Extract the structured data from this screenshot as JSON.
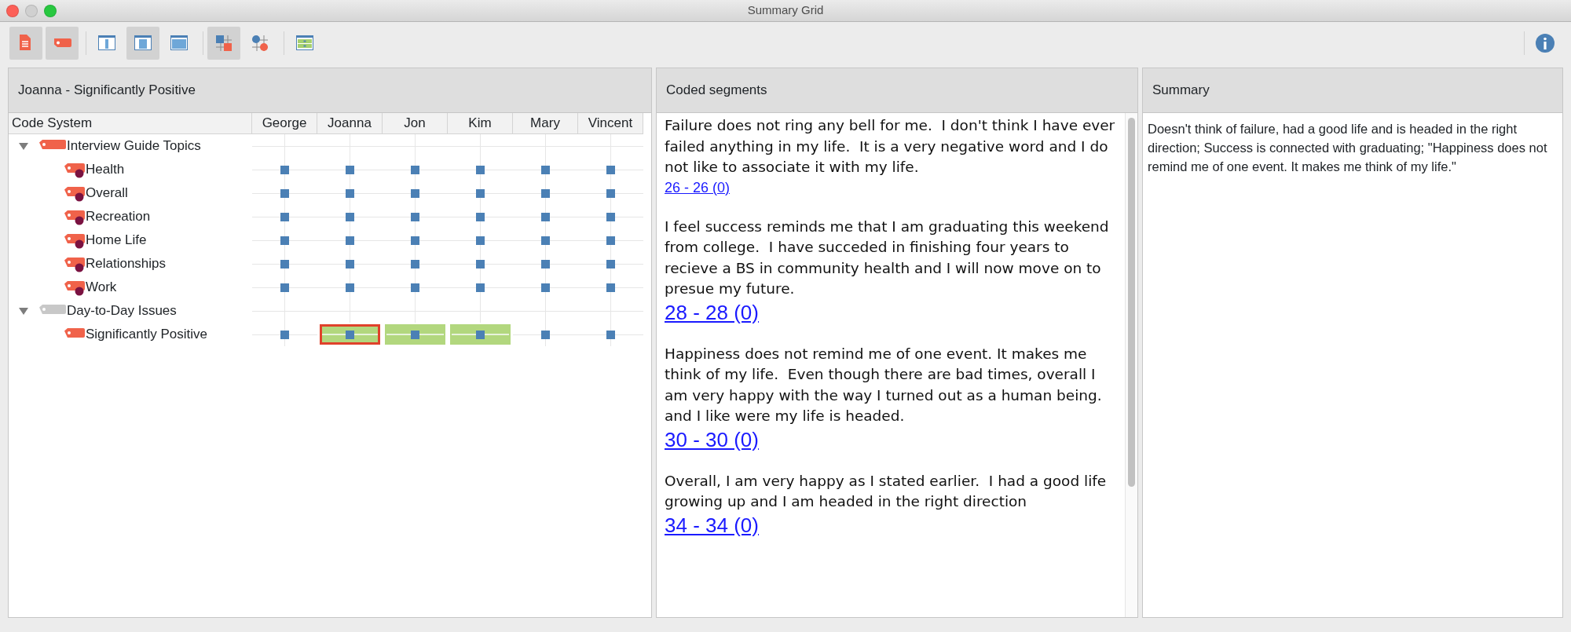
{
  "window": {
    "title": "Summary Grid",
    "minimize_enabled": false
  },
  "toolbar": {
    "groups": [
      [
        {
          "kind": "document",
          "selected": true
        },
        {
          "kind": "tag",
          "selected": true
        }
      ],
      [
        {
          "kind": "layout-narrow",
          "selected": false
        },
        {
          "kind": "layout-wide",
          "selected": true
        },
        {
          "kind": "layout-full",
          "selected": false
        }
      ],
      [
        {
          "kind": "grid-squares",
          "selected": true
        },
        {
          "kind": "grid-circles",
          "selected": false
        }
      ],
      [
        {
          "kind": "table-rows",
          "selected": false
        }
      ]
    ]
  },
  "grid_panel": {
    "title": "Joanna - Significantly Positive",
    "columns": [
      "Code System",
      "George",
      "Joanna",
      "Jon",
      "Kim",
      "Mary",
      "Vincent"
    ],
    "tree": [
      {
        "label": "Interview Guide Topics",
        "color": "#f0624a",
        "expanded": true,
        "children": [
          {
            "label": "Health",
            "color": "#f0624a",
            "has_memo": true,
            "cells": [
              {
                "highlighted": false,
                "selected": false
              },
              {
                "highlighted": false,
                "selected": false
              },
              {
                "highlighted": false,
                "selected": false
              },
              {
                "highlighted": false,
                "selected": false
              },
              {
                "highlighted": false,
                "selected": false
              },
              {
                "highlighted": false,
                "selected": false
              }
            ]
          },
          {
            "label": "Overall",
            "color": "#f0624a",
            "has_memo": true,
            "cells": [
              {
                "highlighted": false,
                "selected": false
              },
              {
                "highlighted": false,
                "selected": false
              },
              {
                "highlighted": false,
                "selected": false
              },
              {
                "highlighted": false,
                "selected": false
              },
              {
                "highlighted": false,
                "selected": false
              },
              {
                "highlighted": false,
                "selected": false
              }
            ]
          },
          {
            "label": "Recreation",
            "color": "#f0624a",
            "has_memo": true,
            "cells": [
              {
                "highlighted": false,
                "selected": false
              },
              {
                "highlighted": false,
                "selected": false
              },
              {
                "highlighted": false,
                "selected": false
              },
              {
                "highlighted": false,
                "selected": false
              },
              {
                "highlighted": false,
                "selected": false
              },
              {
                "highlighted": false,
                "selected": false
              }
            ]
          },
          {
            "label": "Home Life",
            "color": "#f0624a",
            "has_memo": true,
            "cells": [
              {
                "highlighted": false,
                "selected": false
              },
              {
                "highlighted": false,
                "selected": false
              },
              {
                "highlighted": false,
                "selected": false
              },
              {
                "highlighted": false,
                "selected": false
              },
              {
                "highlighted": false,
                "selected": false
              },
              {
                "highlighted": false,
                "selected": false
              }
            ]
          },
          {
            "label": "Relationships",
            "color": "#f0624a",
            "has_memo": true,
            "cells": [
              {
                "highlighted": false,
                "selected": false
              },
              {
                "highlighted": false,
                "selected": false
              },
              {
                "highlighted": false,
                "selected": false
              },
              {
                "highlighted": false,
                "selected": false
              },
              {
                "highlighted": false,
                "selected": false
              },
              {
                "highlighted": false,
                "selected": false
              }
            ]
          },
          {
            "label": "Work",
            "color": "#f0624a",
            "has_memo": true,
            "cells": [
              {
                "highlighted": false,
                "selected": false
              },
              {
                "highlighted": false,
                "selected": false
              },
              {
                "highlighted": false,
                "selected": false
              },
              {
                "highlighted": false,
                "selected": false
              },
              {
                "highlighted": false,
                "selected": false
              },
              {
                "highlighted": false,
                "selected": false
              }
            ]
          }
        ]
      },
      {
        "label": "Day-to-Day Issues",
        "color": "#c8c8c8",
        "expanded": true,
        "children": [
          {
            "label": "Significantly Positive",
            "color": "#f0624a",
            "has_memo": false,
            "cells": [
              {
                "highlighted": false,
                "selected": false
              },
              {
                "highlighted": true,
                "selected": true
              },
              {
                "highlighted": true,
                "selected": false
              },
              {
                "highlighted": true,
                "selected": false
              },
              {
                "highlighted": false,
                "selected": false
              },
              {
                "highlighted": false,
                "selected": false
              }
            ]
          }
        ]
      }
    ]
  },
  "segments_panel": {
    "title": "Coded segments",
    "segments": [
      {
        "text": "Failure does not ring any bell for me.  I don't think I have ever failed anything in my life.  It is a very negative word and I do not like to associate it with my life.",
        "link": "26 - 26  (0)",
        "kind": "small"
      },
      {
        "text": "I feel success reminds me that I am graduating this weekend from college.  I have succeded in finishing four years to recieve a BS in community health and I will now move on to presue my future.",
        "link": "28 - 28  (0)",
        "kind": "large"
      },
      {
        "text": "Happiness does not remind me of one event. It makes me think of my life.  Even though there are bad times, overall I am very happy with the way I turned out as a human being. and I like were my life is headed.",
        "link": "30 - 30  (0)",
        "kind": "large"
      },
      {
        "text": "Overall, I am very happy as I stated earlier.  I had a good life growing up and I am headed in the right direction",
        "link": "34 - 34  (0)",
        "kind": "large"
      }
    ]
  },
  "summary_panel": {
    "title": "Summary",
    "text": "Doesn't think of failure, had a good life and is headed in the right direction; Success is connected with graduating; \"Happiness does not remind me of one event. It makes me think of my life.\""
  }
}
